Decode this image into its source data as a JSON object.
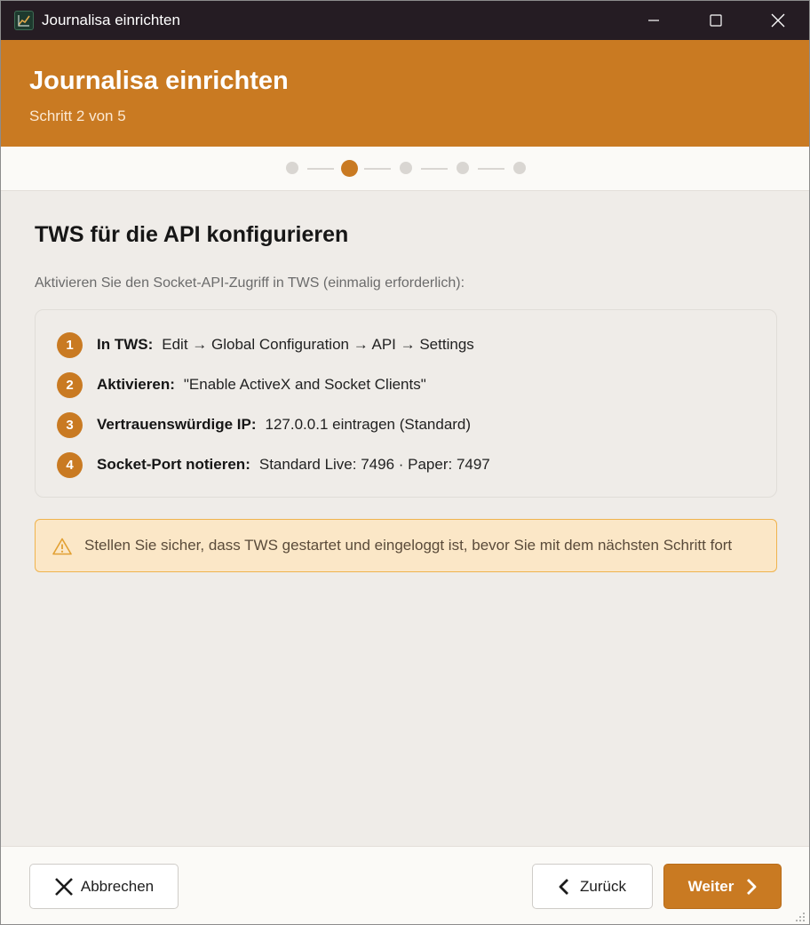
{
  "window": {
    "title": "Journalisa einrichten"
  },
  "header": {
    "title": "Journalisa einrichten",
    "subtitle": "Schritt 2 von 5"
  },
  "progress": {
    "current_step": 2,
    "total_steps": 5
  },
  "content": {
    "title": "TWS für die API konfigurieren",
    "description": "Aktivieren Sie den Socket-API-Zugriff in TWS (einmalig erforderlich):",
    "steps": [
      {
        "number": "1",
        "label": "In TWS:",
        "text": "Edit → Global Configuration → API → Settings"
      },
      {
        "number": "2",
        "label": "Aktivieren:",
        "text": "\"Enable ActiveX and Socket Clients\""
      },
      {
        "number": "3",
        "label": "Vertrauenswürdige IP:",
        "text": "127.0.0.1 eintragen (Standard)"
      },
      {
        "number": "4",
        "label": "Socket-Port notieren:",
        "text": "Standard Live: 7496 · Paper: 7497"
      }
    ],
    "warning": "Stellen Sie sicher, dass TWS gestartet und eingeloggt ist, bevor Sie mit dem nächsten Schritt fort"
  },
  "footer": {
    "cancel_label": "Abbrechen",
    "back_label": "Zurück",
    "next_label": "Weiter"
  },
  "colors": {
    "accent": "#c97a22",
    "titlebar": "#251c23",
    "warning_bg": "#fbe7c7",
    "warning_border": "#efb34e"
  },
  "icons": {
    "app": "chart-app-icon",
    "minimize": "minimize-icon",
    "maximize": "maximize-icon",
    "close": "close-icon",
    "warning": "warning-triangle-icon",
    "cancel": "x-icon",
    "back": "chevron-left-icon",
    "next": "chevron-right-icon"
  }
}
